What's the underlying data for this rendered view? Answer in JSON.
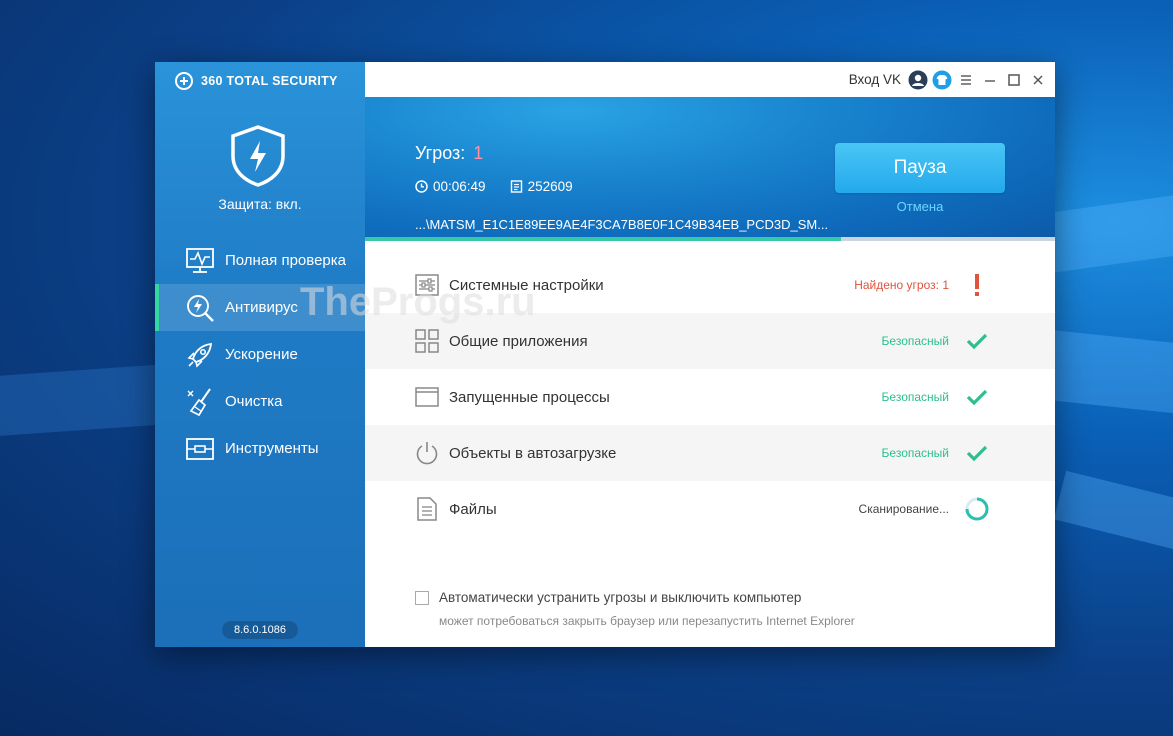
{
  "app": {
    "brand": "360 TOTAL SECURITY",
    "protection_status": "Защита: вкл.",
    "version": "8.6.0.1086"
  },
  "sidebar": {
    "items": [
      {
        "label": "Полная проверка",
        "icon": "monitor-pulse-icon",
        "active": false
      },
      {
        "label": "Антивирус",
        "icon": "bolt-search-icon",
        "active": true
      },
      {
        "label": "Ускорение",
        "icon": "rocket-icon",
        "active": false
      },
      {
        "label": "Очистка",
        "icon": "broom-icon",
        "active": false
      },
      {
        "label": "Инструменты",
        "icon": "toolbox-icon",
        "active": false
      }
    ]
  },
  "titlebar": {
    "login": "Вход VK"
  },
  "scan": {
    "threats_label": "Угроз:",
    "threats_count": "1",
    "time": "00:06:49",
    "files": "252609",
    "current_path": "...\\MATSM_E1C1E89EE9AE4F3CA7B8E0F1C49B34EB_PCD3D_SM...",
    "progress": 0.69,
    "pause_label": "Пауза",
    "cancel_label": "Отмена"
  },
  "rows": [
    {
      "label": "Системные настройки",
      "status": "Найдено угроз: 1",
      "state": "threat"
    },
    {
      "label": "Общие приложения",
      "status": "Безопасный",
      "state": "safe"
    },
    {
      "label": "Запущенные процессы",
      "status": "Безопасный",
      "state": "safe"
    },
    {
      "label": "Объекты в автозагрузке",
      "status": "Безопасный",
      "state": "safe"
    },
    {
      "label": "Файлы",
      "status": "Сканирование...",
      "state": "scanning"
    }
  ],
  "auto_fix": {
    "label": "Автоматически устранить угрозы и выключить компьютер",
    "note": "может потребоваться закрыть браузер или перезапустить Internet Explorer",
    "checked": false
  },
  "watermark": "TheProgs.ru",
  "colors": {
    "accent": "#23a9ec",
    "safe": "#2dbf8e",
    "threat": "#e0533d",
    "progress": "#35c9a8"
  }
}
